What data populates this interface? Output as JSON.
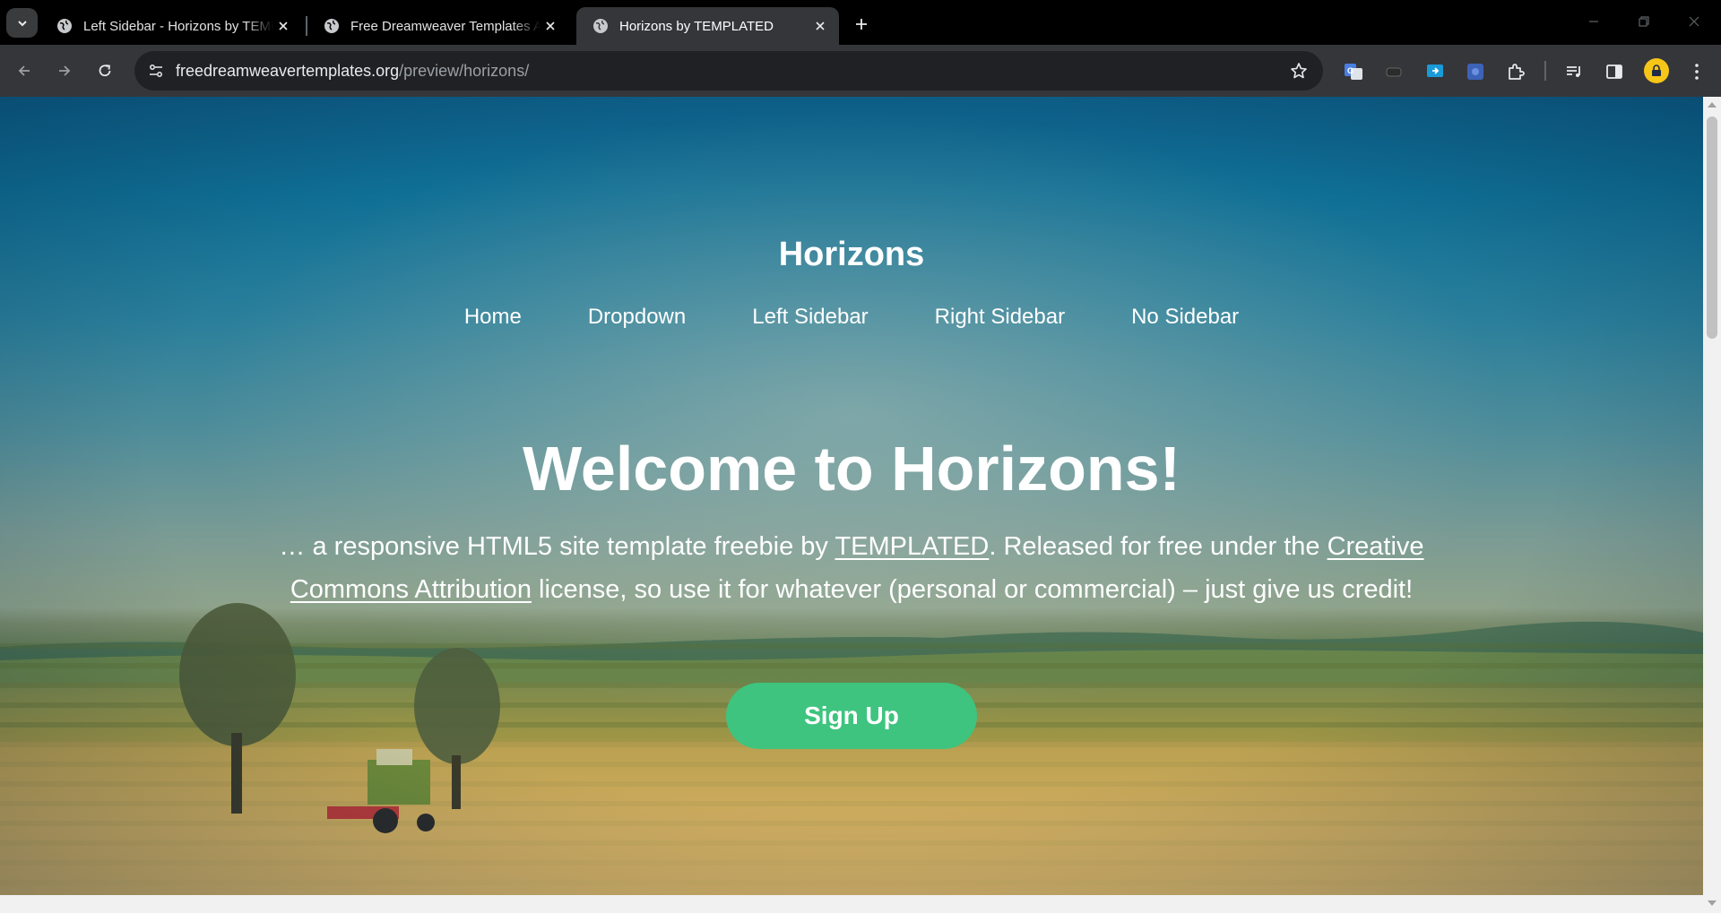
{
  "browser": {
    "tabs": [
      {
        "title": "Left Sidebar - Horizons by TEMPLATED",
        "active": false
      },
      {
        "title": "Free Dreamweaver Templates Archive",
        "active": false
      },
      {
        "title": "Horizons by TEMPLATED",
        "active": true
      }
    ],
    "address": {
      "domain": "freedreamweavertemplates.org",
      "path": "/preview/horizons/"
    }
  },
  "site": {
    "title": "Horizons",
    "nav": [
      "Home",
      "Dropdown",
      "Left Sidebar",
      "Right Sidebar",
      "No Sidebar"
    ]
  },
  "hero": {
    "heading": "Welcome to Horizons!",
    "text_part1": "… a responsive HTML5 site template freebie by ",
    "link1": "TEMPLATED",
    "text_part2": ". Released for free under the ",
    "link2": "Creative Commons Attribution",
    "text_part3": " license, so use it for whatever (personal or commercial) – just give us credit!",
    "button": "Sign Up"
  },
  "colors": {
    "button": "#3ec47f",
    "sky": "#0f6f95",
    "field": "#c5a65a"
  }
}
